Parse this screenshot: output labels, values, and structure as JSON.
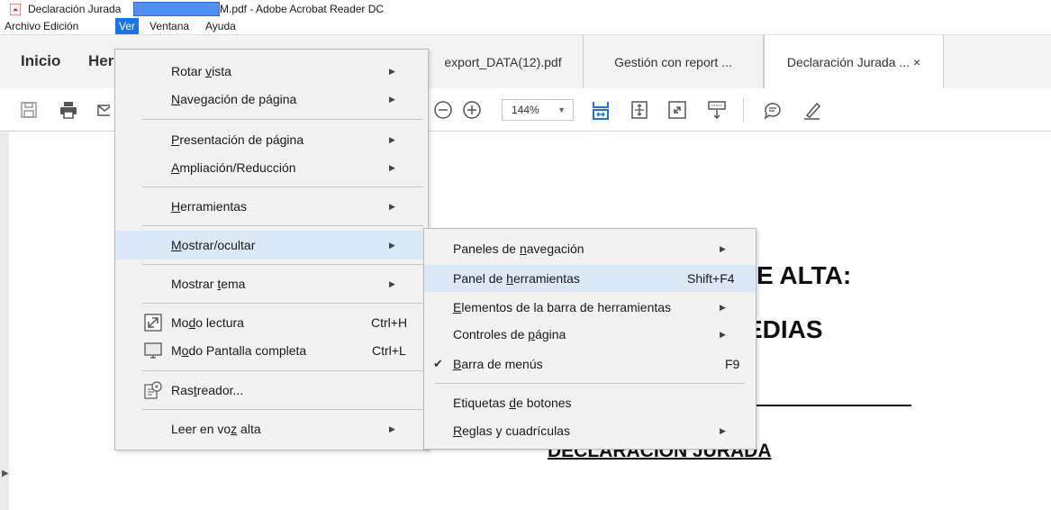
{
  "window": {
    "title_prefix": "Declaración Jurada ",
    "title_suffix": "M.pdf - Adobe Acrobat Reader DC"
  },
  "menubar": {
    "items": [
      "Archivo",
      "Edición",
      "Ver",
      "Ventana",
      "Ayuda"
    ]
  },
  "tabs": {
    "home": "Inicio",
    "tools": "Her",
    "documents": [
      "export_DATA(12).pdf",
      "Gestión con report ...",
      "Declaración Jurada ...  ×"
    ]
  },
  "toolbar": {
    "zoom": "144%"
  },
  "document": {
    "line1": "E ALTA:",
    "line2": "EDIAS",
    "heading": "DECLARACION JURADA"
  },
  "ver_menu": {
    "rotar": {
      "pre": "Rotar ",
      "u": "v",
      "post": "ista"
    },
    "navegacion": {
      "pre": "",
      "u": "N",
      "post": "avegación de página"
    },
    "presentacion": {
      "pre": "",
      "u": "P",
      "post": "resentación de página"
    },
    "ampliacion": {
      "pre": "",
      "u": "A",
      "post": "mpliación/Reducción"
    },
    "herramientas": {
      "pre": "",
      "u": "H",
      "post": "erramientas"
    },
    "mostrar": {
      "pre": "",
      "u": "M",
      "post": "ostrar/ocultar"
    },
    "tema": {
      "pre": "Mostrar ",
      "u": "t",
      "post": "ema"
    },
    "lectura": {
      "pre": "Mo",
      "u": "d",
      "post": "o lectura",
      "shortcut": "Ctrl+H"
    },
    "pantalla": {
      "pre": "M",
      "u": "o",
      "post": "do Pantalla completa",
      "shortcut": "Ctrl+L"
    },
    "rastreador": {
      "pre": "Ras",
      "u": "t",
      "post": "reador..."
    },
    "leer": {
      "pre": "Leer en vo",
      "u": "z",
      "post": " alta"
    }
  },
  "submenu": {
    "paneles": {
      "pre": "Paneles de ",
      "u": "n",
      "post": "avegación"
    },
    "panel_herr": {
      "pre": "Panel de ",
      "u": "h",
      "post": "erramientas",
      "shortcut": "Shift+F4"
    },
    "elementos": {
      "pre": "",
      "u": "E",
      "post": "lementos de la barra de herramientas"
    },
    "controles": {
      "pre": "Controles de ",
      "u": "p",
      "post": "ágina"
    },
    "barra": {
      "pre": "",
      "u": "B",
      "post": "arra de menús",
      "shortcut": "F9",
      "check": "✔"
    },
    "etiquetas": {
      "pre": "Etiquetas ",
      "u": "d",
      "post": "e botones"
    },
    "reglas": {
      "pre": "",
      "u": "R",
      "post": "eglas y cuadrículas"
    }
  },
  "colors": {
    "accent": "#1a73e8",
    "highlight": "#dbe8f6",
    "menu_bg": "#f2f2f2",
    "redaction": "#4f8ff0"
  }
}
